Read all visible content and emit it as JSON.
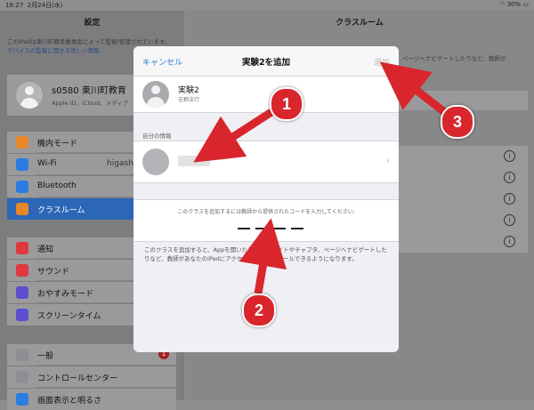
{
  "status": {
    "time": "18:27",
    "date": "2月24日(水)",
    "battery": "30%"
  },
  "sidebar": {
    "title": "設定",
    "supervised_note": "このiPadは東川町教育委員会によって監督/管理されています。",
    "supervised_link": "デバイスの監督に関する詳しい情報...",
    "account_name": "s0580 東川町教育",
    "account_sub": "Apple ID、iCloud、メディア",
    "groups": [
      [
        {
          "label": "機内モード",
          "icon": "airplane-icon",
          "color": "#e8862a"
        },
        {
          "label": "Wi-Fi",
          "value": "higashika",
          "icon": "wifi-icon",
          "color": "#2a7de1"
        },
        {
          "label": "Bluetooth",
          "icon": "bluetooth-icon",
          "color": "#2a7de1"
        },
        {
          "label": "クラスルーム",
          "icon": "classroom-icon",
          "color": "#e8862a",
          "selected": true
        }
      ],
      [
        {
          "label": "通知",
          "icon": "notification-icon",
          "color": "#e0383e"
        },
        {
          "label": "サウンド",
          "icon": "sound-icon",
          "color": "#e0383e"
        },
        {
          "label": "おやすみモード",
          "icon": "moon-icon",
          "color": "#5b4fcf"
        },
        {
          "label": "スクリーンタイム",
          "icon": "hourglass-icon",
          "color": "#5b4fcf"
        }
      ],
      [
        {
          "label": "一般",
          "icon": "gear-icon",
          "color": "#8e8e93",
          "badge": "1"
        },
        {
          "label": "コントロールセンター",
          "icon": "control-center-icon",
          "color": "#8e8e93"
        },
        {
          "label": "画面表示と明るさ",
          "icon": "display-icon",
          "color": "#2a7de1"
        }
      ]
    ]
  },
  "detail": {
    "title": "クラスルーム",
    "note": "ページへナビゲートしたりなど、教師が"
  },
  "modal": {
    "cancel": "キャンセル",
    "title": "実験2を追加",
    "add": "追加",
    "class_name": "実験2",
    "class_teacher": "吉野泫行",
    "section_label": "自分の情報",
    "code_prompt": "このクラスを追加するには教師から提供されたコードを入力してください:",
    "footnote": "このクラスを追加すると、Appを開いたり、Webサイトやチャプタ、ページへナビゲートしたりなど、教師があなたのiPadにアクセスし、コントロールできるようになります。"
  },
  "markers": [
    "1",
    "2",
    "3"
  ],
  "colors": {
    "accent": "#2a7de1",
    "marker": "#d8262c"
  }
}
